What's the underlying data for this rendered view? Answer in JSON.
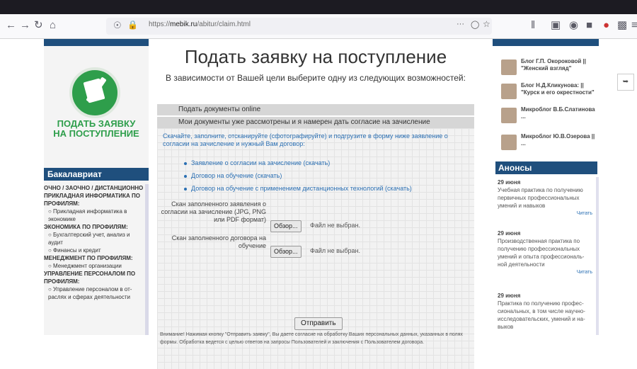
{
  "browser": {
    "url_prefix": "https://",
    "url_domain": "mebik.ru",
    "url_path": "/abitur/claim.html",
    "dots": "···"
  },
  "left": {
    "apply_title_1": "ПОДАТЬ ЗАЯВКУ",
    "apply_title_2": "НА ПОСТУПЛЕНИЕ",
    "bakalavriat": "Бакалавриат",
    "nav": [
      {
        "type": "sec",
        "text": "очно / заочно / дистанционно"
      },
      {
        "type": "sec",
        "text": "ПРИКЛАДНАЯ ИНФОРМАТИКА ПО ПРОФИЛЯМ:"
      },
      {
        "type": "itm",
        "text": "○ Прикладная информатика в экономике"
      },
      {
        "type": "sec",
        "text": "ЭКОНОМИКА ПО ПРОФИЛЯМ:"
      },
      {
        "type": "itm",
        "text": "○ Бухгалтерский учет, анализ и аудит"
      },
      {
        "type": "itm",
        "text": "○ Финансы и кредит"
      },
      {
        "type": "sec",
        "text": "МЕНЕДЖМЕНТ ПО ПРОФИЛЯМ:"
      },
      {
        "type": "itm",
        "text": "○ Менеджмент организации"
      },
      {
        "type": "sec",
        "text": "УПРАВЛЕНИЕ ПЕРСОНАЛОМ ПО ПРОФИЛЯМ:"
      },
      {
        "type": "itm",
        "text": "○ Управление персоналом в от-раслях и сферах деятельности"
      }
    ]
  },
  "main": {
    "title": "Подать заявку на поступление",
    "subtitle": "В зависимости от Вашей цели выберите одну из следующих возможностей:",
    "bar1": "Подать документы online",
    "bar2": "Мои документы уже рассмотрены и я намерен дать согласие на зачисление",
    "intro": "Скачайте, заполните, отсканируйте (сфотографируйте) и подгрузите в форму ниже заявление о согласии на зачисление и нужный Вам договор:",
    "links": [
      "Заявление о согласии на зачисление (скачать)",
      "Договор на обучение (скачать)",
      "Договор на обучение с применением дистанционных технологий (скачать)"
    ],
    "label1": "Скан заполненного заявления о согласии на зачисление (JPG, PNG или PDF формат)",
    "label2": "Скан заполненного договора на обучение",
    "browse": "Обзор...",
    "no_file": "Файл не выбран.",
    "submit": "Отправить",
    "note": "Внимание! Нажимая кнопку \"Отправить заявку\", Вы даете согласие на обработку Ваших персональных данных, указанных в полях формы. Обработка ведется с целью ответов на запросы Пользователей и заключения с Пользователем договора."
  },
  "right": {
    "blogs": [
      "Блог Г.П. Окороковой || \"Женский взгляд\"",
      "Блог Н.Д.Кликунова: || \"Курск и его окрестности\"",
      "Микроблог В.Б.Слатинова ...",
      "Микроблог Ю.В.Озерова || ..."
    ],
    "anons": "Анонсы",
    "news": [
      {
        "date": "29 июня",
        "text": "Учебная практика по получению первичных профессиональных умений и навыков",
        "more": "Читать"
      },
      {
        "date": "29 июня",
        "text": "Производственная практика по получению профессиональных умений и опыта профессиональ-ной деятельности",
        "more": "Читать"
      },
      {
        "date": "29 июня",
        "text": "Практика по получению профес-сиональных, в том числе научно-исследовательских, умений и на-выков",
        "more": ""
      }
    ]
  },
  "colors": {
    "accent": "#1f4f7d",
    "green": "#2e9e4b",
    "link": "#2a6fb3"
  }
}
